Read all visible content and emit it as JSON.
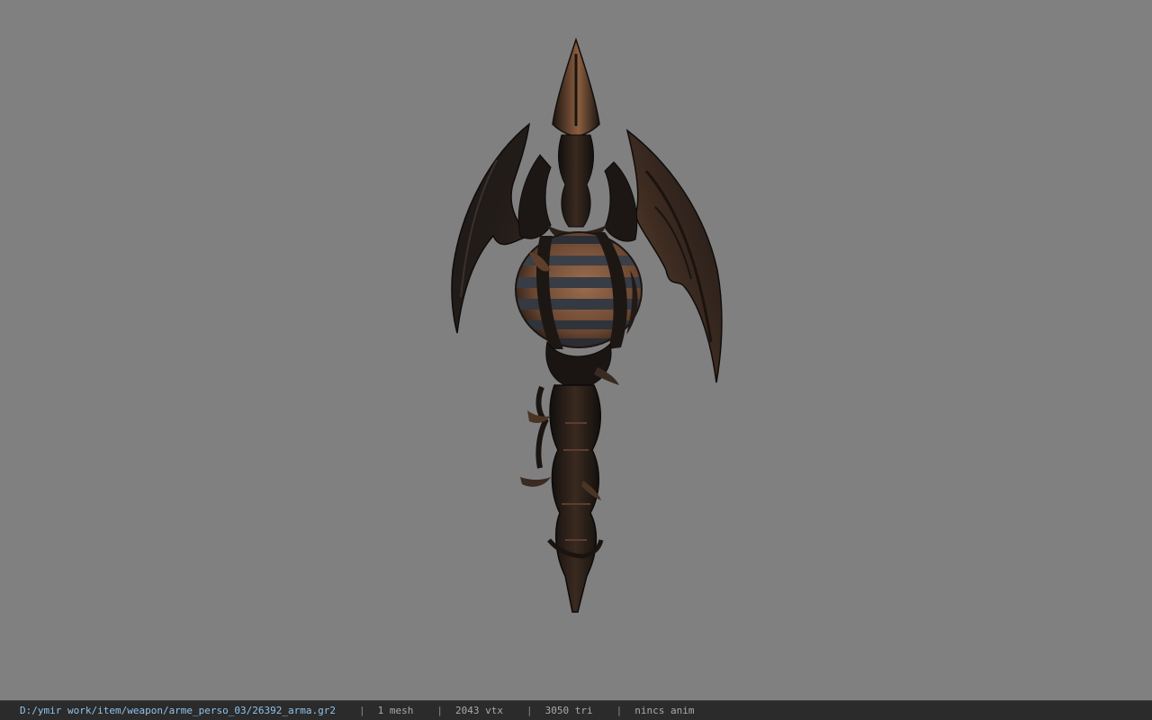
{
  "viewport": {
    "background": "#808080",
    "model_name": "26392_arma.gr2"
  },
  "status_bar": {
    "file_path": "D:/ymir work/item/weapon/arme_perso_03/26392_arma.gr2",
    "separator": "|",
    "mesh_count": "1 mesh",
    "vertex_count": "2043 vtx",
    "triangle_count": "3050 tri",
    "animation": "nincs anim"
  }
}
